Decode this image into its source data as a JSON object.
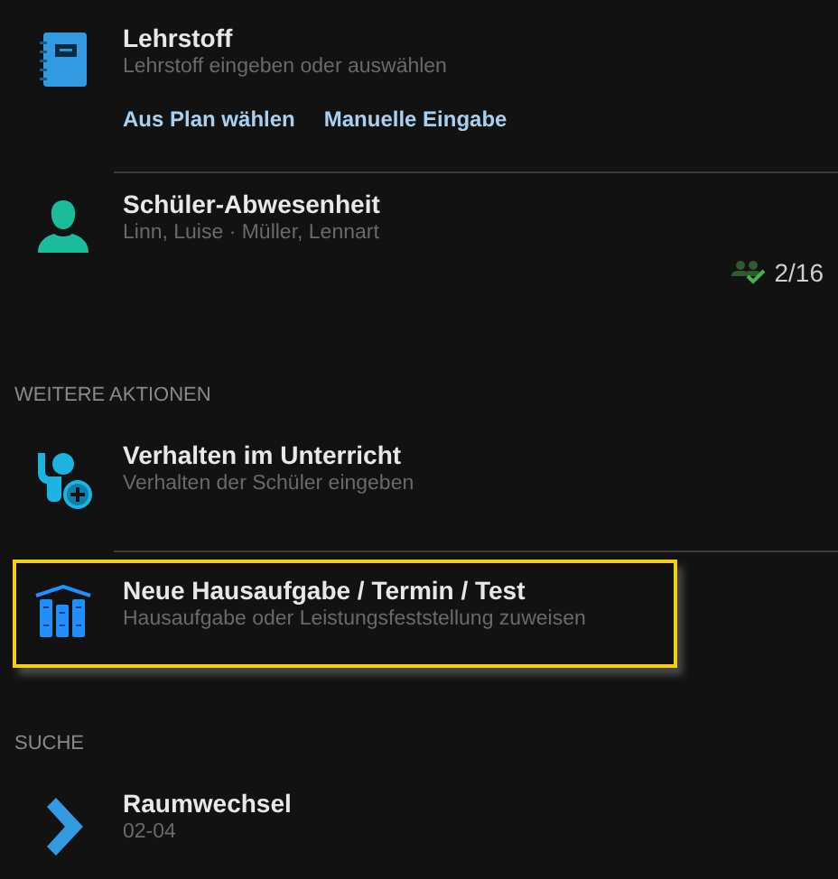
{
  "groups": [
    {
      "items": [
        {
          "kind": "notebook",
          "title": "Lehrstoff",
          "subtitle": "Lehrstoff eingeben oder auswählen",
          "selected": false,
          "links": [
            "Aus Plan wählen",
            "Manuelle Eingabe"
          ]
        },
        {
          "kind": "person",
          "title": "Schüler-Abwesenheit",
          "subtitle": "Linn, Luise · Müller, Lennart",
          "selected": false,
          "count": "2/16"
        }
      ]
    },
    {
      "header": "WEITERE AKTIONEN",
      "items": [
        {
          "kind": "hand",
          "title": "Verhalten im Unterricht",
          "subtitle": "Verhalten der Schüler eingeben",
          "selected": false
        },
        {
          "kind": "books",
          "title": "Neue Hausaufgabe / Termin / Test",
          "subtitle": "Hausaufgabe oder Leistungsfeststellung zuweisen",
          "selected": true
        }
      ]
    },
    {
      "header": "SUCHE",
      "items": [
        {
          "kind": "chevron",
          "title": "Raumwechsel",
          "subtitle": "02-04",
          "selected": false
        }
      ]
    }
  ]
}
